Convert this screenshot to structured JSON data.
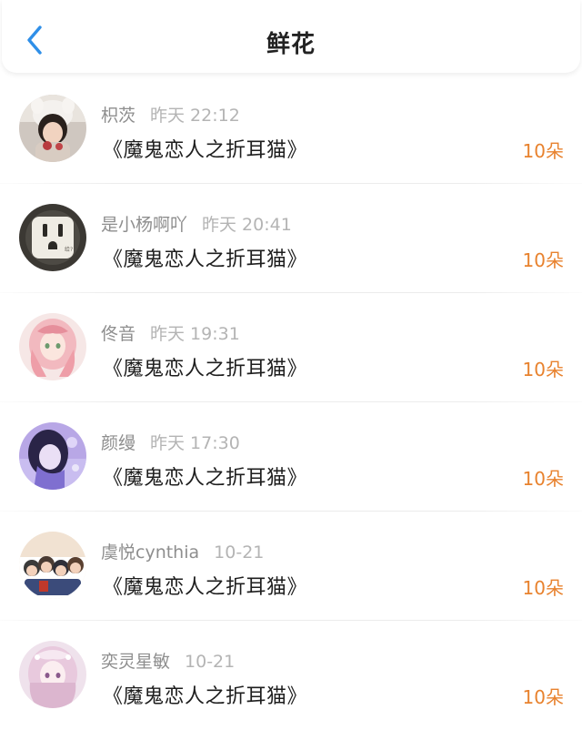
{
  "header": {
    "title": "鲜花",
    "back_icon": "chevron-left-icon",
    "accent_color": "#2f8fe8"
  },
  "records": [
    {
      "user": "枳茨",
      "time": "昨天 22:12",
      "book": "《魔鬼恋人之折耳猫》",
      "amount": "10朵",
      "avatar_icon": "avatar-child-photo"
    },
    {
      "user": "是小杨啊吖",
      "time": "昨天 20:41",
      "book": "《魔鬼恋人之折耳猫》",
      "amount": "10朵",
      "avatar_icon": "avatar-power-socket"
    },
    {
      "user": "佟音",
      "time": "昨天 19:31",
      "book": "《魔鬼恋人之折耳猫》",
      "amount": "10朵",
      "avatar_icon": "avatar-pink-hair-girl"
    },
    {
      "user": "颜缦",
      "time": "昨天 17:30",
      "book": "《魔鬼恋人之折耳猫》",
      "amount": "10朵",
      "avatar_icon": "avatar-purple-girl"
    },
    {
      "user": "虞悦cynthia",
      "time": "10-21",
      "book": "《魔鬼恋人之折耳猫》",
      "amount": "10朵",
      "avatar_icon": "avatar-cartoon-group"
    },
    {
      "user": "奕灵星敏",
      "time": "10-21",
      "book": "《魔鬼恋人之折耳猫》",
      "amount": "10朵",
      "avatar_icon": "avatar-anime-princess"
    }
  ],
  "colors": {
    "amount": "#e8822e",
    "username": "#8e8e8e",
    "time": "#b4b4b4"
  }
}
